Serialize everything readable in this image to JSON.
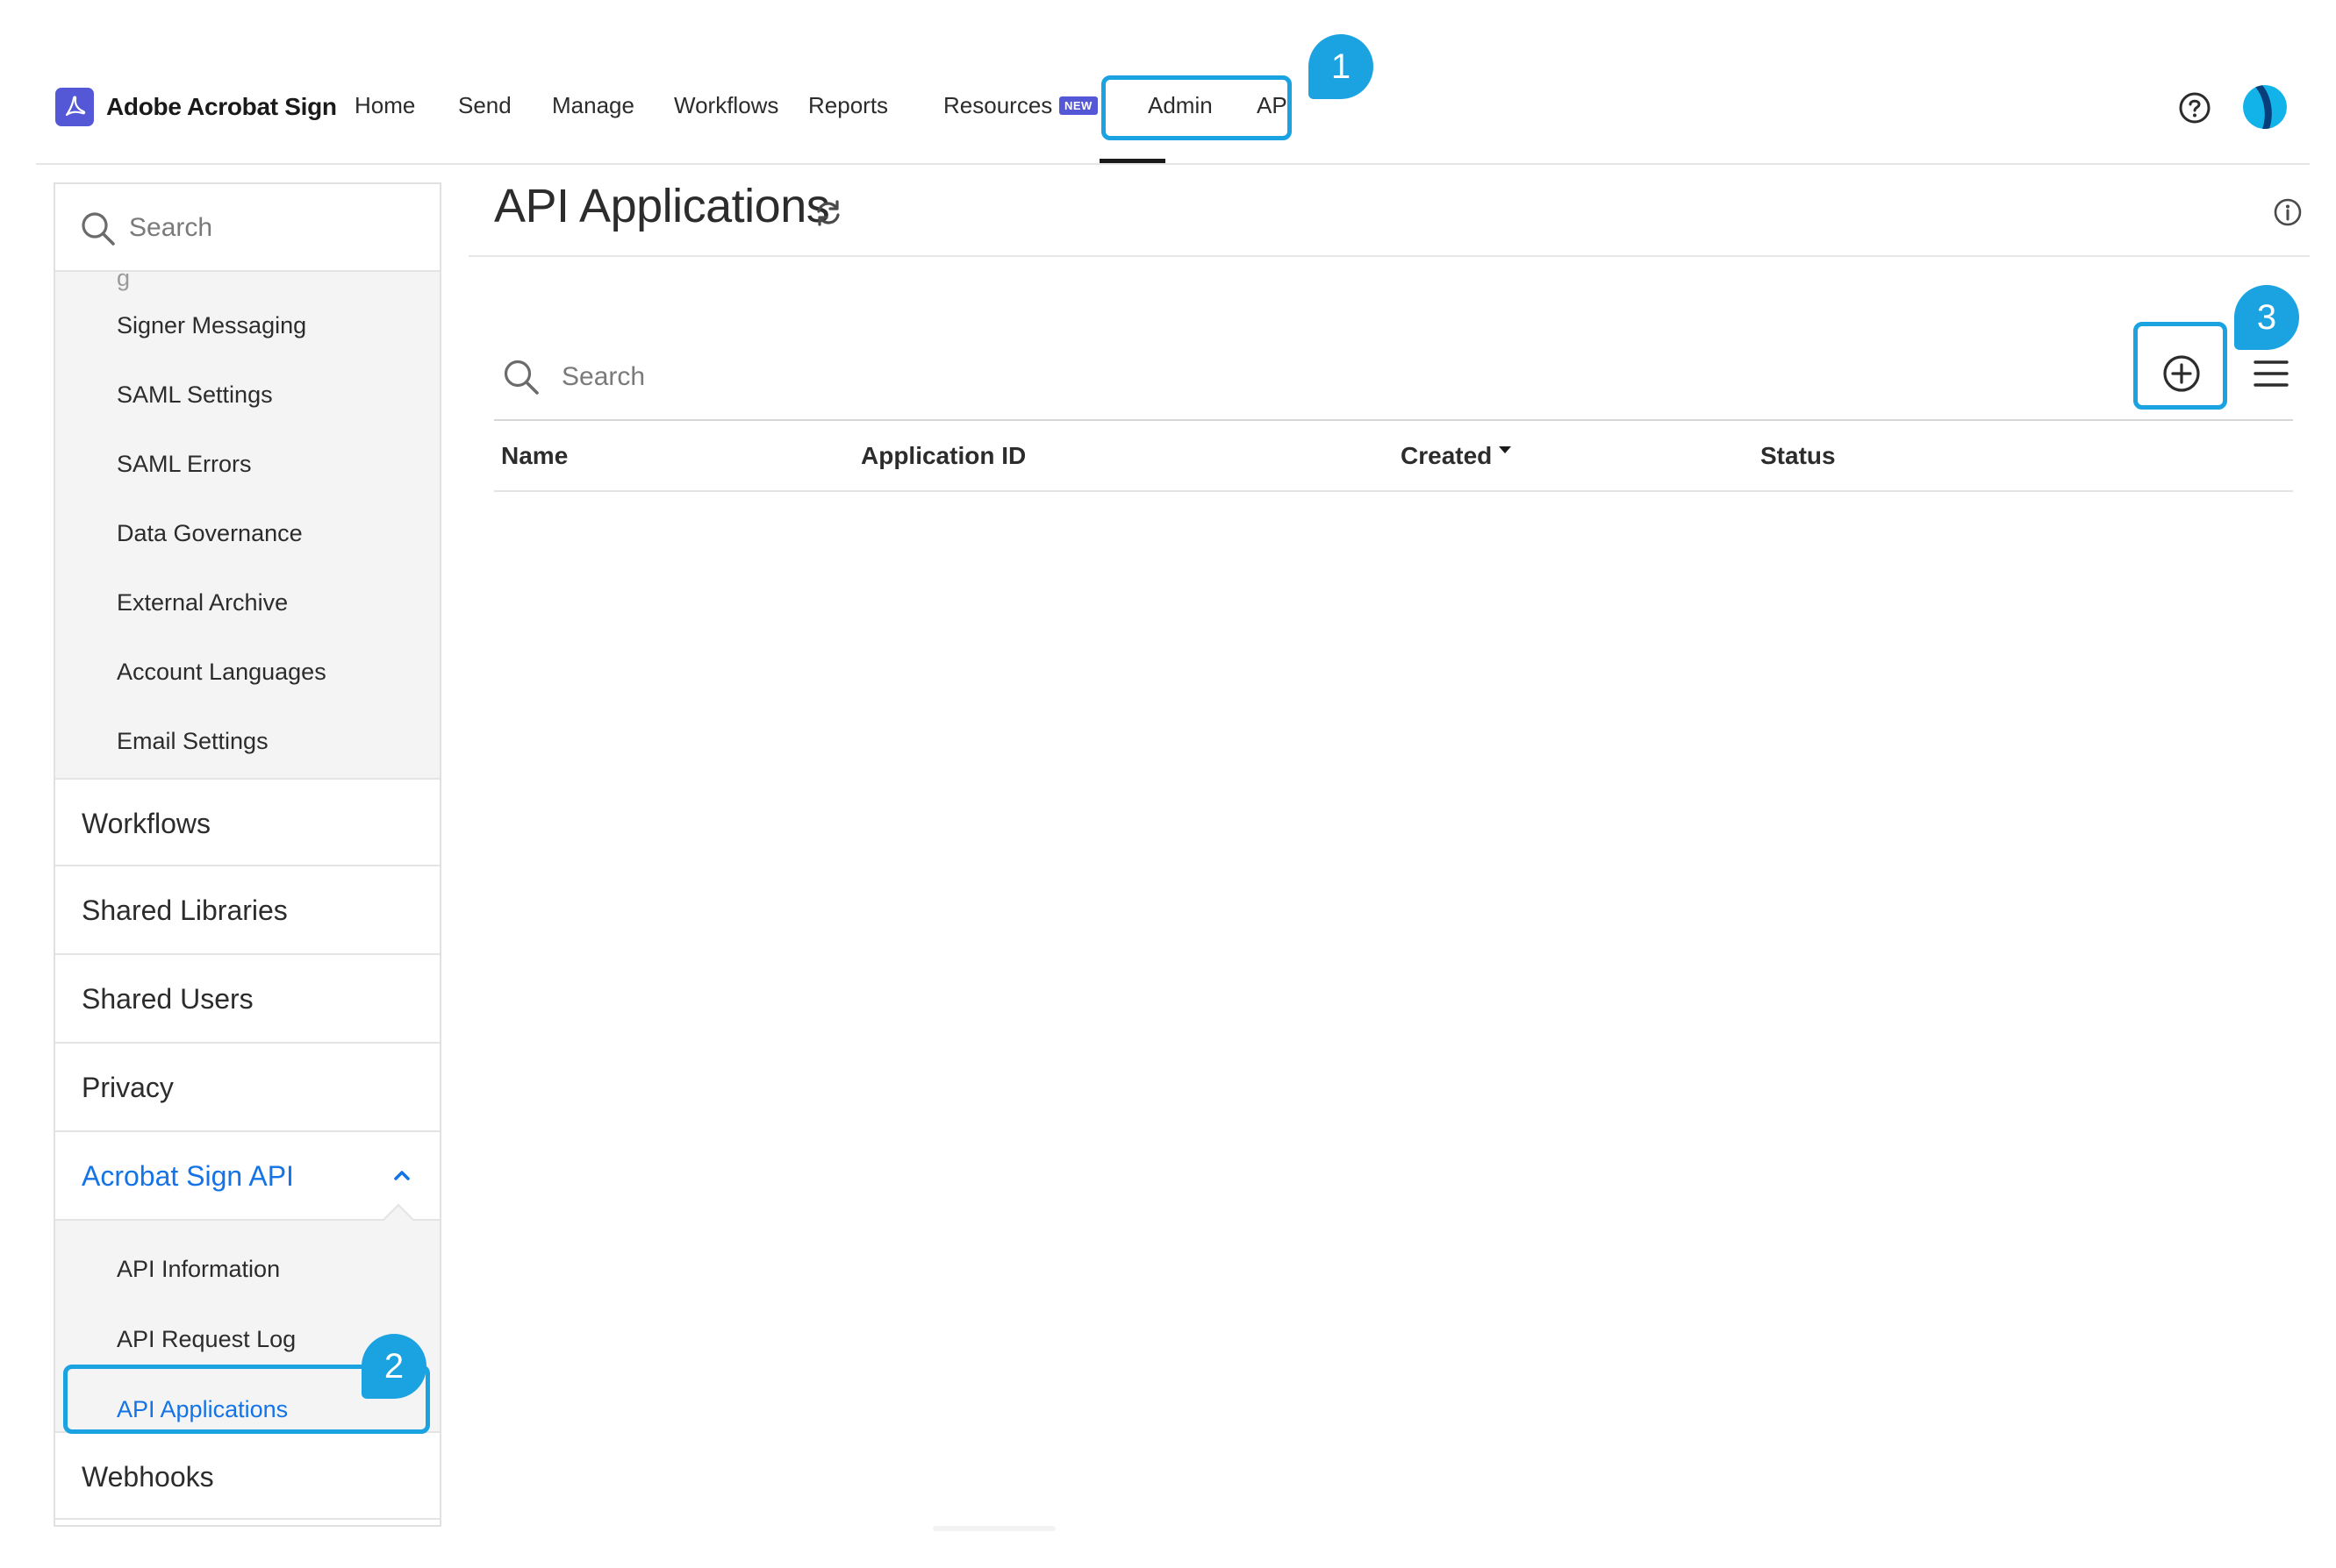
{
  "brand": {
    "name": "Adobe Acrobat Sign"
  },
  "nav": {
    "items": [
      {
        "label": "Home"
      },
      {
        "label": "Send"
      },
      {
        "label": "Manage"
      },
      {
        "label": "Workflows"
      },
      {
        "label": "Reports"
      },
      {
        "label": "Resources"
      },
      {
        "label": "Admin"
      },
      {
        "label": "API"
      }
    ],
    "badge": "NEW",
    "active": "Admin"
  },
  "callouts": {
    "one": "1",
    "two": "2",
    "three": "3"
  },
  "sidebar": {
    "search_placeholder": "Search",
    "account_settings": [
      {
        "label": "Signer Messaging"
      },
      {
        "label": "SAML Settings"
      },
      {
        "label": "SAML Errors"
      },
      {
        "label": "Data Governance"
      },
      {
        "label": "External Archive"
      },
      {
        "label": "Account Languages"
      },
      {
        "label": "Email Settings"
      }
    ],
    "sections": [
      {
        "label": "Workflows"
      },
      {
        "label": "Shared Libraries"
      },
      {
        "label": "Shared Users"
      },
      {
        "label": "Privacy"
      },
      {
        "label": "Acrobat Sign API",
        "expanded": true
      },
      {
        "label": "Webhooks"
      }
    ],
    "api_items": [
      {
        "label": "API Information"
      },
      {
        "label": "API Request Log"
      },
      {
        "label": "API Applications",
        "active": true
      }
    ]
  },
  "main": {
    "title": "API Applications",
    "search_placeholder": "Search",
    "table": {
      "columns": [
        "Name",
        "Application ID",
        "Created",
        "Status"
      ],
      "sort_column": "Created",
      "rows": []
    }
  },
  "colors": {
    "accent": "#1473e6",
    "callout": "#1ba3e1",
    "brand": "#5458d6"
  }
}
